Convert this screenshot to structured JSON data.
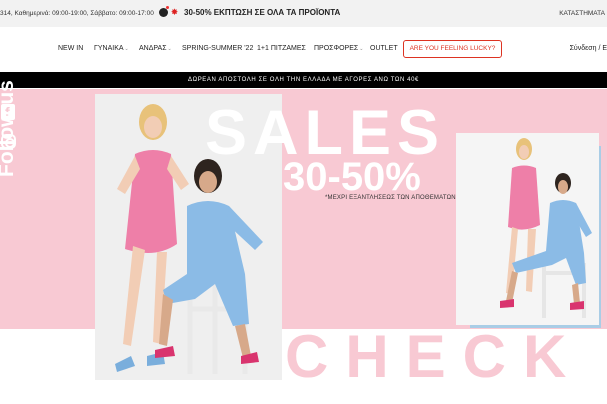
{
  "topbar": {
    "hours": "314, Καθημερινά: 09:00-19:00, Σάββατο: 09:00-17:00",
    "promo_icons": [
      "bomb-icon",
      "firework-icon"
    ],
    "promo": "30-50% ΕΚΠΤΩΣΗ ΣΕ ΟΛΑ ΤΑ ΠΡΟΪΟΝΤΑ",
    "stores": "ΚΑΤΑΣΤΗΜΑΤΑ"
  },
  "nav": {
    "items": [
      {
        "label": "NEW IN",
        "dropdown": false
      },
      {
        "label": "ΓΥΝΑΙΚΑ",
        "dropdown": true
      },
      {
        "label": "ΑΝΔΡΑΣ",
        "dropdown": true
      },
      {
        "label": "SPRING-SUMMER '22",
        "dropdown": false
      },
      {
        "label": "1+1 ΠΙΤΖΑΜΕΣ",
        "dropdown": false
      },
      {
        "label": "ΠΡΟΣΦΟΡΕΣ",
        "dropdown": true
      },
      {
        "label": "OUTLET",
        "dropdown": false
      }
    ],
    "lucky": "ARE YOU FEELING LUCKY?",
    "login": "Σύνδεση / Ε"
  },
  "shipping_banner": "ΔΩΡΕΑΝ ΑΠΟΣΤΟΛΗ ΣΕ ΟΛΗ ΤΗΝ ΕΛΛΑΔΑ ΜΕ ΑΓΟΡΕΣ ΑΝΩ ΤΩΝ 40€",
  "hero": {
    "social": [
      "facebook-icon",
      "instagram-icon"
    ],
    "follow": "Follow us",
    "sales": "SALES",
    "percent": "30-50%",
    "until": "*ΜΕΧΡΙ ΕΞΑΝΤΛΗΣΕΩΣ ΤΩΝ ΑΠΟΘΕΜΑΤΩΝ",
    "check": "CHECK"
  },
  "colors": {
    "hero_pink": "#f8c9d3",
    "lucky_red": "#d33322",
    "dress_pink": "#ee7fa8",
    "jumpsuit_blue": "#8bbbe6",
    "side_shadow": "#a9cde6"
  }
}
